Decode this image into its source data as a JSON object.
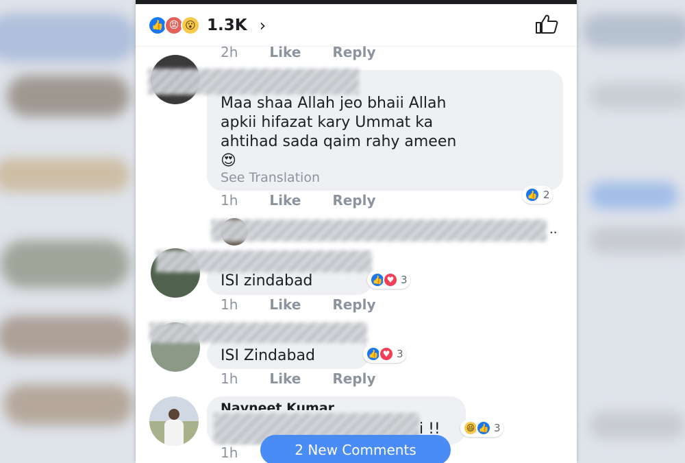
{
  "reactions_header": {
    "icons": [
      "like-icon",
      "angry-icon",
      "wow-icon"
    ],
    "count": "1.3K",
    "chevron": "›"
  },
  "action_labels": {
    "like": "Like",
    "reply": "Reply"
  },
  "comments": [
    {
      "time": "2h"
    },
    {
      "text_lines": [
        "Maa shaa Allah jeo bhaii Allah",
        "apkii hifazat kary Ummat ka",
        "ahtihad sada qaim rahy ameen"
      ],
      "emoji": "😍",
      "see_translation": "See Translation",
      "reaction_count": "2",
      "time": "1h"
    },
    {
      "text": "ISI zindabad",
      "reaction_count": "3",
      "time": "1h"
    },
    {
      "text": "ISI Zindabad",
      "reaction_count": "3",
      "time": "1h"
    },
    {
      "author": "Navneet Kumar",
      "text_tail": "i !!",
      "reaction_count": "3",
      "time": "1h"
    }
  ],
  "reply_ellipsis": "..",
  "new_comments_label": "2 New Comments",
  "colors": {
    "accent": "#1877f2",
    "pill": "#4a8cf5",
    "bubble": "#eef0f3",
    "meta": "#8d949e"
  }
}
